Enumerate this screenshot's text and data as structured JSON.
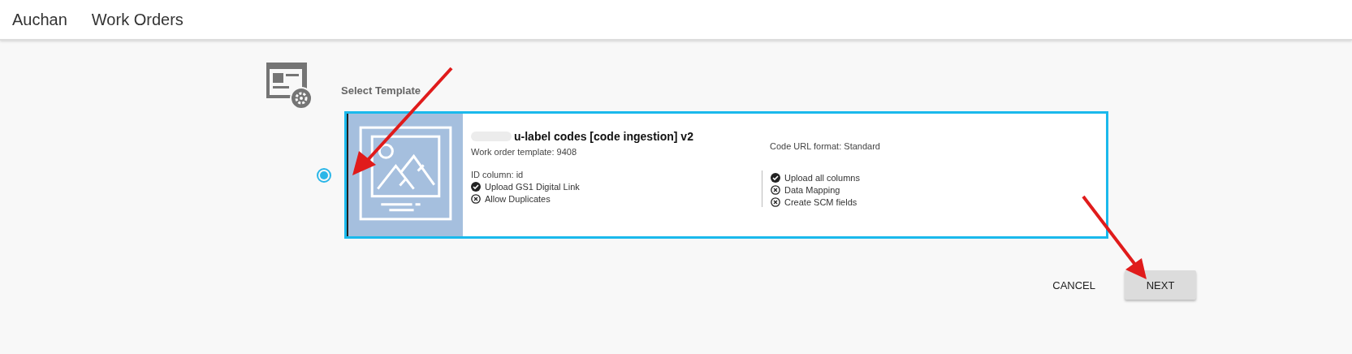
{
  "header": {
    "items": [
      "Auchan",
      "Work Orders"
    ]
  },
  "section": {
    "title": "Select Template"
  },
  "templates": [
    {
      "selected": true,
      "kind": "picture",
      "title": "u-label codes [code ingestion] v2",
      "subtitle": "Work order template: 9408",
      "url_format": "Code URL format: Standard",
      "id_column": "ID column: id",
      "left_features": [
        {
          "label": "Upload GS1 Digital Link",
          "enabled": true
        },
        {
          "label": "Allow Duplicates",
          "enabled": false
        }
      ],
      "right_features": [
        {
          "label": "Upload all columns",
          "enabled": true
        },
        {
          "label": "Data Mapping",
          "enabled": false
        },
        {
          "label": "Create SCM fields",
          "enabled": false
        }
      ]
    }
  ],
  "buttons": [
    {
      "label": "CANCEL",
      "kind": "flat"
    },
    {
      "label": "NEXT",
      "kind": "raised"
    }
  ]
}
